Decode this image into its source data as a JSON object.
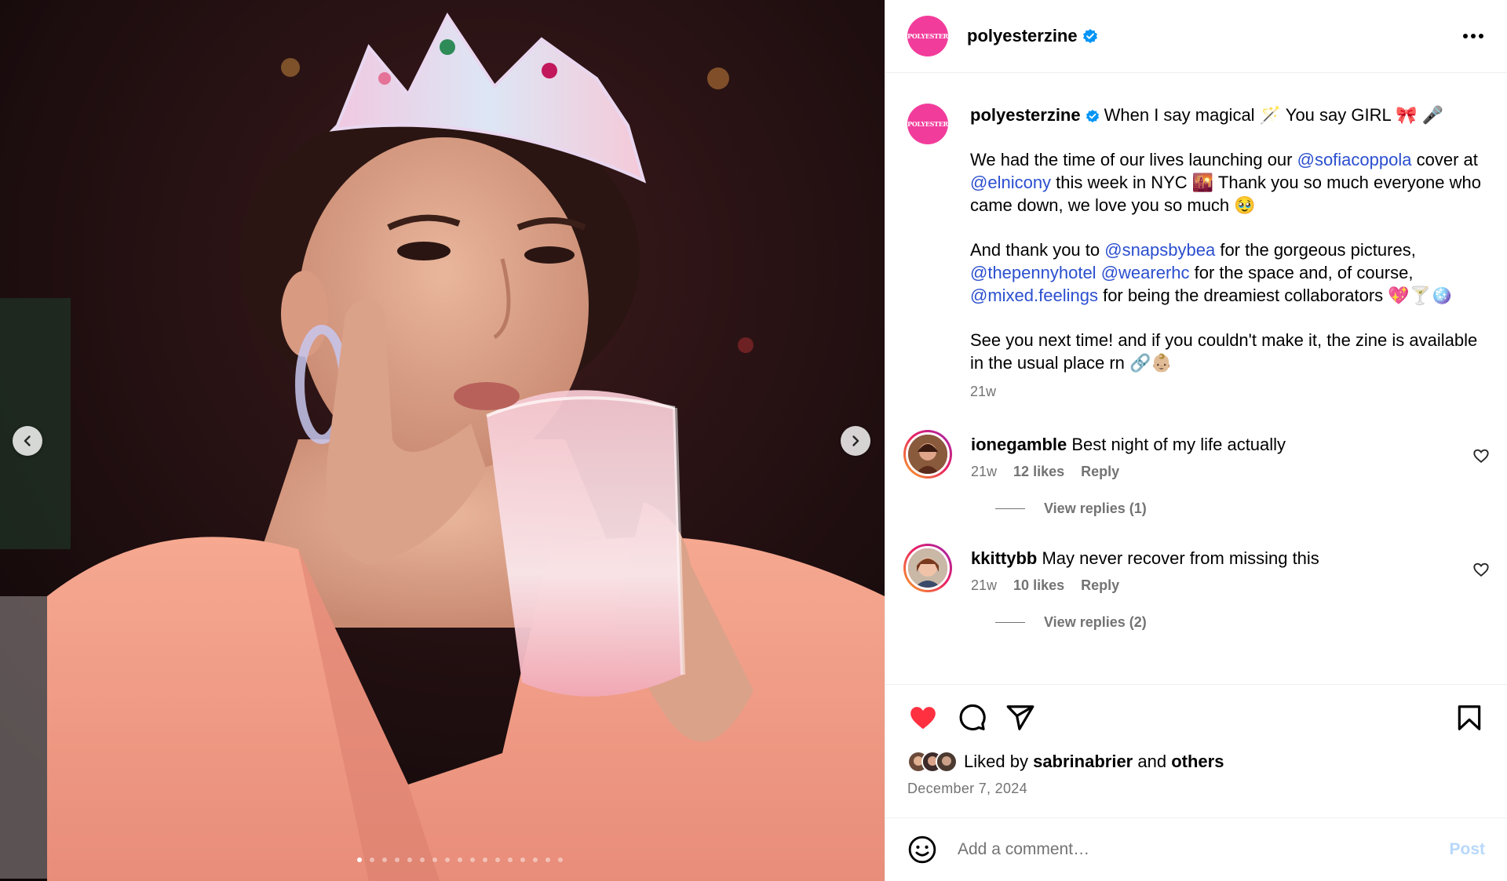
{
  "post": {
    "username": "polyesterzine",
    "brand_avatar_text": "POLYESTER",
    "brand_color": "#f23c9b"
  },
  "caption": {
    "username": "polyesterzine",
    "line1": "When I say magical 🪄 You say GIRL 🎀 🎤",
    "p2_a": "We had the time of our lives launching our ",
    "p2_m1": "@sofiacoppola",
    "p2_b": " cover at ",
    "p2_m2": "@elnicony",
    "p2_c": " this week in NYC 🌇 Thank you so much everyone who came down, we love you so much 🥹",
    "p3_a": "And thank you to ",
    "p3_m1": "@snapsbybea",
    "p3_b": " for the gorgeous pictures, ",
    "p3_m2": "@thepennyhotel",
    "p3_sp": " ",
    "p3_m3": "@wearerhc",
    "p3_c": " for the space and, of course, ",
    "p3_m4": "@mixed.feelings",
    "p3_d": " for being the dreamiest collaborators 💖🍸🪩",
    "p4": "See you next time! and if you couldn't make it, the zine is available in the usual place rn 🔗👶🏼",
    "time": "21w"
  },
  "comments": [
    {
      "username": "ionegamble",
      "text": "Best night of my life actually",
      "time": "21w",
      "likes": "12 likes",
      "reply": "Reply",
      "view_replies": "View replies (1)"
    },
    {
      "username": "kkittybb",
      "text": "May never recover from missing this",
      "time": "21w",
      "likes": "10 likes",
      "reply": "Reply",
      "view_replies": "View replies (2)"
    }
  ],
  "likes": {
    "prefix": "Liked by ",
    "user": "sabrinabrier",
    "mid": " and ",
    "others": "others"
  },
  "date": "December 7, 2024",
  "composer": {
    "placeholder": "Add a comment…",
    "post_label": "Post"
  },
  "carousel": {
    "slide_count": 17,
    "active_index": 0
  },
  "colors": {
    "like_red": "#ff3040",
    "mention_blue": "#2b4fcf",
    "muted": "#737373"
  }
}
